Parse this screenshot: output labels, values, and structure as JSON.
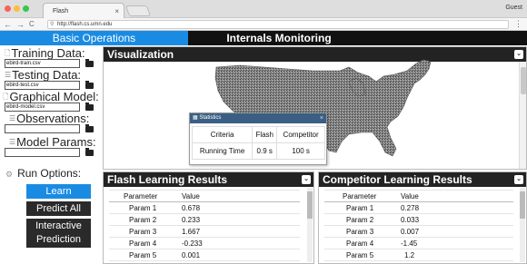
{
  "browser": {
    "tab_title": "Flash",
    "tab_close": "×",
    "profile": "Guest",
    "url": "http://flash.cs.umn.edu",
    "back": "←",
    "forward": "→",
    "reload": "C",
    "menu": "⋮"
  },
  "top_tabs": [
    "Basic Operations",
    "Internals Monitoring"
  ],
  "sidebar": {
    "training_title": "Training Data:",
    "training_value": "ebird-train.csv",
    "testing_title": "Testing Data:",
    "testing_value": "ebird-test.csv",
    "model_title": "Graphical Model:",
    "model_value": "ebird-model.csv",
    "observations_title": "Observations:",
    "observations_value": "",
    "params_title": "Model Params:",
    "params_value": "",
    "run_title": "Run Options:",
    "buttons": {
      "learn": "Learn",
      "predict_all": "Predict All",
      "interactive_1": "Interactive",
      "interactive_2": "Prediction"
    }
  },
  "visualization": {
    "title": "Visualization",
    "chevron": "⌄",
    "stats": {
      "title": "Statistics",
      "close": "×",
      "headers": [
        "Criteria",
        "Flash",
        "Competitor"
      ],
      "rows": [
        [
          "Running Time",
          "0.9 s",
          "100 s"
        ]
      ]
    }
  },
  "flash_results": {
    "title": "Flash Learning Results",
    "headers": [
      "Parameter",
      "Value"
    ],
    "rows": [
      [
        "Param 1",
        "0.678"
      ],
      [
        "Param 2",
        "0.233"
      ],
      [
        "Param 3",
        "1.667"
      ],
      [
        "Param 4",
        "-0.233"
      ],
      [
        "Param 5",
        "0.001"
      ]
    ]
  },
  "competitor_results": {
    "title": "Competitor Learning Results",
    "headers": [
      "Parameter",
      "Value"
    ],
    "rows": [
      [
        "Param 1",
        "0.278"
      ],
      [
        "Param 2",
        "0.033"
      ],
      [
        "Param 3",
        "0.007"
      ],
      [
        "Param 4",
        "-1.45"
      ],
      [
        "Param 5",
        "1.2"
      ]
    ]
  },
  "colors": {
    "accent": "#1a8be3",
    "dark": "#232323",
    "dialog_header": "#3a5f84"
  }
}
